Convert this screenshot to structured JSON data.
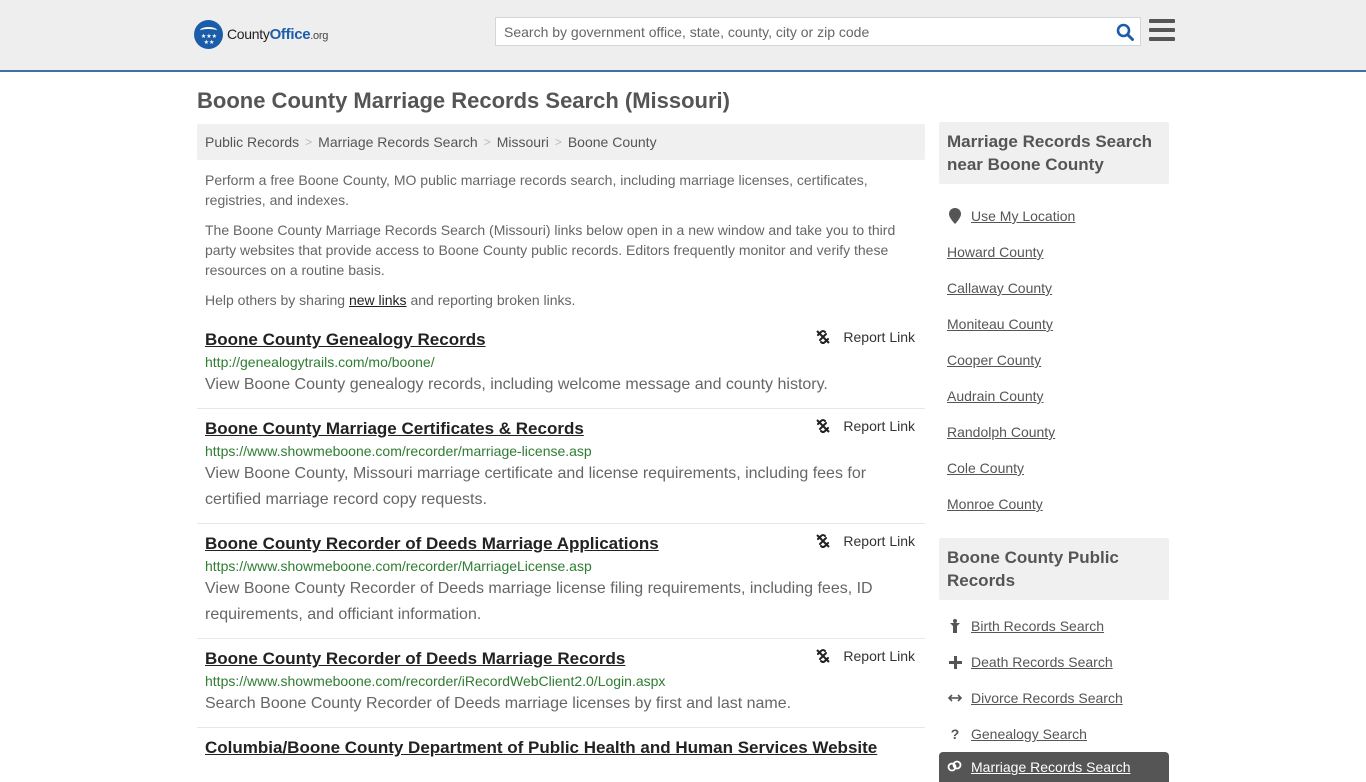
{
  "header": {
    "logo": {
      "name": "County",
      "name_bold": "Office",
      "tld": ".org",
      "stars": "★★★ ★★"
    },
    "search": {
      "placeholder": "Search by government office, state, county, city or zip code",
      "value": ""
    }
  },
  "page_title": "Boone County Marriage Records Search (Missouri)",
  "breadcrumb": [
    {
      "label": "Public Records"
    },
    {
      "label": "Marriage Records Search"
    },
    {
      "label": "Missouri"
    },
    {
      "label": "Boone County"
    }
  ],
  "breadcrumb_sep": ">",
  "intro": {
    "p1": "Perform a free Boone County, MO public marriage records search, including marriage licenses, certificates, registries, and indexes.",
    "p2": "The Boone County Marriage Records Search (Missouri) links below open in a new window and take you to third party websites that provide access to Boone County public records. Editors frequently monitor and verify these resources on a routine basis.",
    "p3_before": "Help others by sharing ",
    "p3_link": "new links",
    "p3_after": " and reporting broken links."
  },
  "report_label": "Report Link",
  "entries": [
    {
      "title": "Boone County Genealogy Records",
      "url": "http://genealogytrails.com/mo/boone/",
      "desc": "View Boone County genealogy records, including welcome message and county history."
    },
    {
      "title": "Boone County Marriage Certificates & Records",
      "url": "https://www.showmeboone.com/recorder/marriage-license.asp",
      "desc": "View Boone County, Missouri marriage certificate and license requirements, including fees for certified marriage record copy requests."
    },
    {
      "title": "Boone County Recorder of Deeds Marriage Applications",
      "url": "https://www.showmeboone.com/recorder/MarriageLicense.asp",
      "desc": "View Boone County Recorder of Deeds marriage license filing requirements, including fees, ID requirements, and officiant information."
    },
    {
      "title": "Boone County Recorder of Deeds Marriage Records",
      "url": "https://www.showmeboone.com/recorder/iRecordWebClient2.0/Login.aspx",
      "desc": "Search Boone County Recorder of Deeds marriage licenses by first and last name."
    },
    {
      "title": "Columbia/Boone County Department of Public Health and Human Services Website",
      "url": "",
      "desc": ""
    }
  ],
  "sidebar": {
    "nearby": {
      "heading": "Marriage Records Search near Boone County",
      "use_location": "Use My Location",
      "counties": [
        "Howard County",
        "Callaway County",
        "Moniteau County",
        "Cooper County",
        "Audrain County",
        "Randolph County",
        "Cole County",
        "Monroe County"
      ]
    },
    "public_records": {
      "heading": "Boone County Public Records",
      "items": [
        {
          "label": "Birth Records Search",
          "icon": "child-icon"
        },
        {
          "label": "Death Records Search",
          "icon": "plus-icon"
        },
        {
          "label": "Divorce Records Search",
          "icon": "arrows-icon"
        },
        {
          "label": "Genealogy Search",
          "icon": "question-icon"
        }
      ],
      "active": {
        "label": "Marriage Records Search",
        "icon": "rings-icon"
      }
    }
  },
  "colors": {
    "brand": "#1b5da8",
    "url_green": "#2e7d32",
    "header_border": "#3f6fa8"
  }
}
